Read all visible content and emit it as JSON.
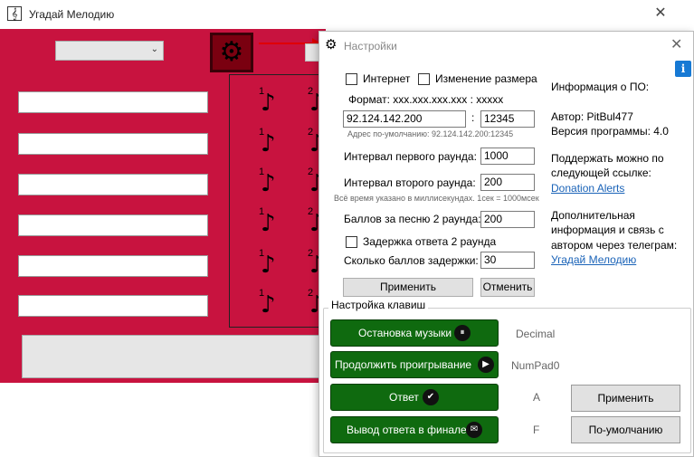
{
  "window": {
    "title": "Угадай Мелодию",
    "app_icon": "𝄞",
    "close_glyph": "✕"
  },
  "main": {
    "gear_glyph": "⚙",
    "combo_arrow": "⌄",
    "note_numbers": [
      "1",
      "1",
      "1",
      "1",
      "1",
      "1",
      "2",
      "2",
      "2",
      "2",
      "2",
      "2"
    ],
    "note_glyph": "♪"
  },
  "settings": {
    "title": "Настройки",
    "gear_glyph": "⚙",
    "close_glyph": "✕",
    "info_glyph": "i",
    "internet_label": "Интернет",
    "resize_label": "Изменение размера",
    "format_label": "Формат: xxx.xxx.xxx.xxx : xxxxx",
    "ip_value": "92.124.142.200",
    "colon": ":",
    "port_value": "12345",
    "default_address": "Адрес по-умолчанию: 92.124.142.200:12345",
    "round1_interval_label": "Интервал первого раунда:",
    "round1_interval_value": "1000",
    "round2_interval_label": "Интервал второго раунда:",
    "round2_interval_value": "200",
    "time_note": "Всё время указано в миллисекундах. 1сек = 1000мсек",
    "points_label": "Баллов за песню 2 раунда:",
    "points_value": "200",
    "delay_label": "Задержка ответа 2 раунда",
    "delay_points_label": "Сколько баллов задержки:",
    "delay_points_value": "30",
    "apply_label": "Применить",
    "cancel_label": "Отменить",
    "info": {
      "title": "Информация о ПО:",
      "author": "Автор: PitBul477",
      "version": "Версия программы: 4.0",
      "support_line1": "Поддержать можно по",
      "support_line2": "следующей ссылке:",
      "support_link": "Donation Alerts",
      "extra_line1": "Дополнительная",
      "extra_line2": "информация и связь с",
      "extra_line3": "автором через телеграм:",
      "telegram_link": "Угадай Мелодию"
    },
    "keys": {
      "legend": "Настройка клавиш",
      "items": [
        {
          "label": "Остановка музыки",
          "icon": "⏸",
          "key": "Decimal"
        },
        {
          "label": "Продолжить проигрывание",
          "icon": "▶",
          "key": "NumPad0"
        },
        {
          "label": "Ответ",
          "icon": "✔",
          "key": "A"
        },
        {
          "label": "Вывод ответа в финале",
          "icon": "✉",
          "key": "F"
        }
      ],
      "apply_label": "Применить",
      "default_label": "По-умолчанию"
    }
  }
}
